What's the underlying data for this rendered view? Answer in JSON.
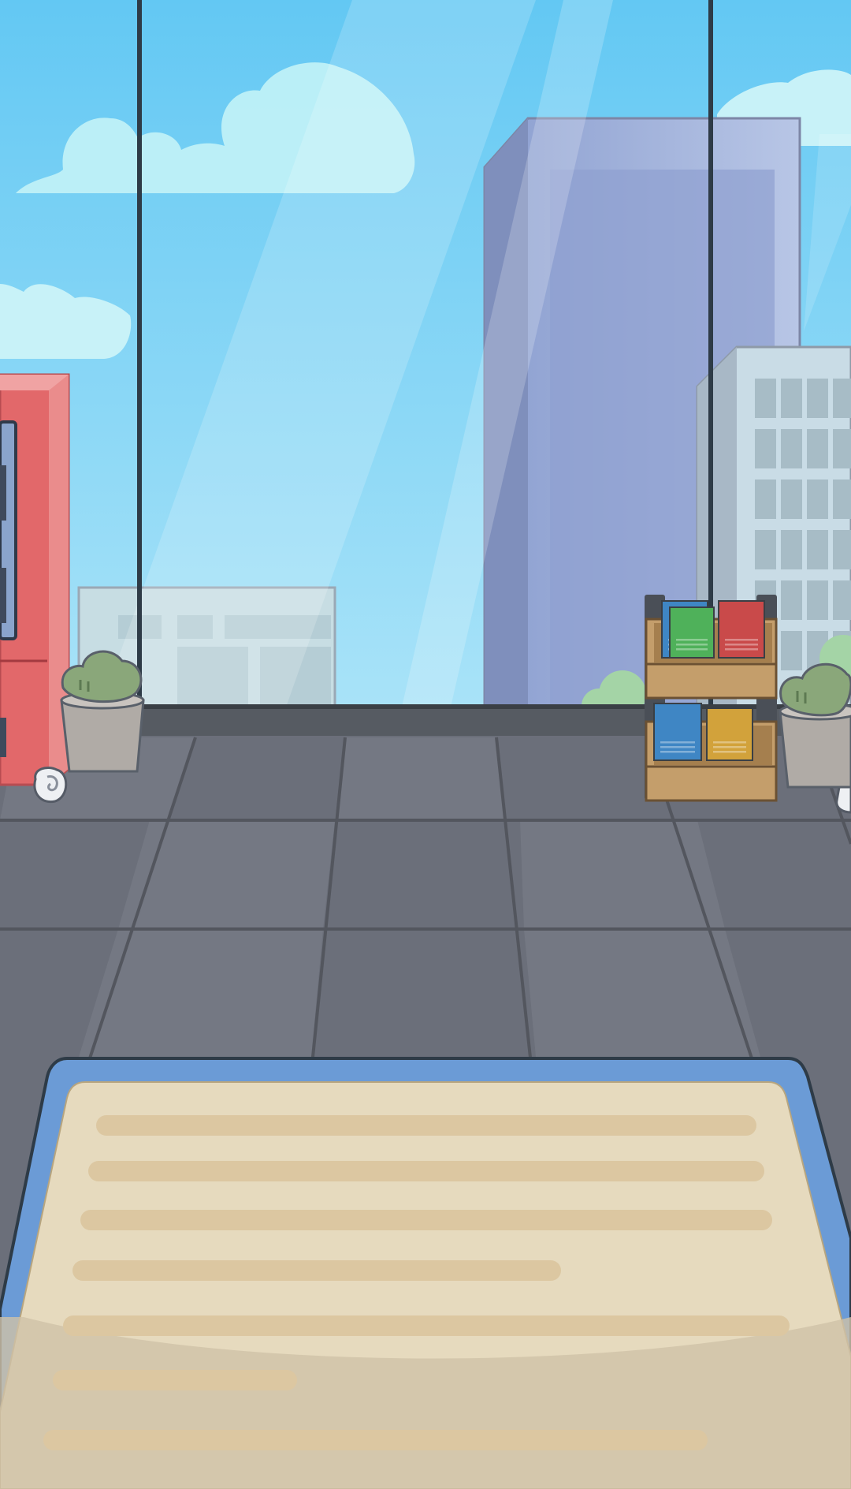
{
  "scene": {
    "name": "office-window-lounge",
    "elements": {
      "window": "floor-to-ceiling-window",
      "buildings": [
        "tall-blue-tower",
        "grid-office-building",
        "low-building"
      ],
      "props": [
        "vending-machine",
        "potted-plant-left",
        "potted-plant-right",
        "book-rack"
      ],
      "book_colors": [
        "#3f86c4",
        "#4fb15a",
        "#c94a4a",
        "#3f86c4",
        "#d2a23b"
      ],
      "floor": "tiled-floor",
      "dialog": "dialog-panel"
    },
    "colors": {
      "sky": "#6ccdf3",
      "floor": "#6b6f7a",
      "panel_frame": "#6b9bd6",
      "panel_paper": "#e6dabe",
      "vending_machine": "#e2686a"
    }
  },
  "dialog_panel": {
    "text_lines": [],
    "placeholder_lines": 7
  }
}
